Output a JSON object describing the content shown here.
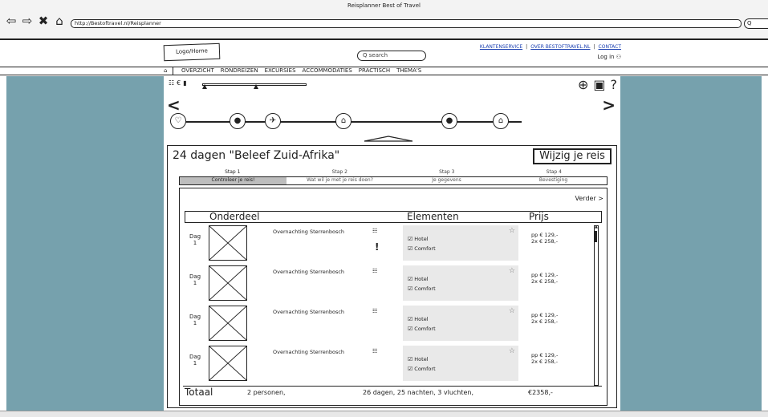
{
  "window": {
    "title": "Reisplanner Best of Travel"
  },
  "browser": {
    "url": "http://Bestoftravel.nl/Reisplanner",
    "search_placeholder": "Q"
  },
  "header": {
    "logo": "Logo/Home",
    "search_placeholder": "search",
    "links": [
      "KLANTENSERVICE",
      "OVER BESTOFTRAVEL.NL",
      "CONTACT"
    ],
    "login": "Log in"
  },
  "menu": {
    "items": [
      "OVERZICHT",
      "RONDREIZEN",
      "EXCURSIES",
      "ACCOMMODATIES",
      "PRACTISCH",
      "THEMA'S"
    ]
  },
  "trip": {
    "title": "24 dagen \"Beleef Zuid-Afrika\"",
    "change_button": "Wijzig je reis",
    "steps": [
      "Stap 1",
      "Stap 2",
      "Stap 3",
      "Stap 4"
    ],
    "step_tabs": [
      "Controleer je reis!",
      "Wat wil je met je reis doen?",
      "Je gegevens",
      "Bevestiging"
    ],
    "next": "Verder >",
    "columns": {
      "part": "Onderdeel",
      "elements": "Elementen",
      "price": "Prijs"
    },
    "rows": [
      {
        "day": "Dag",
        "day_num": "1",
        "part": "Overnachting Sterrenbosch",
        "el1": "Hotel",
        "el2": "Comfort",
        "price1": "pp € 129,-",
        "price2": "2x € 258,-"
      },
      {
        "day": "Dag",
        "day_num": "1",
        "part": "Overnachting Sterrenbosch",
        "el1": "Hotel",
        "el2": "Comfort",
        "price1": "pp € 129,-",
        "price2": "2x € 258,-"
      },
      {
        "day": "Dag",
        "day_num": "1",
        "part": "Overnachting Sterrenbosch",
        "el1": "Hotel",
        "el2": "Comfort",
        "price1": "pp € 129,-",
        "price2": "2x € 258,-"
      },
      {
        "day": "Dag",
        "day_num": "1",
        "part": "Overnachting Sterrenbosch",
        "el1": "Hotel",
        "el2": "Comfort",
        "price1": "pp € 129,-",
        "price2": "2x € 258,-"
      }
    ],
    "total": {
      "label": "Totaal",
      "persons": "2 personen,",
      "summary": "26 dagen, 25 nachten, 3 vluchten,",
      "amount": "€2358,-"
    }
  },
  "colors": {
    "side_bg": "#76a1ad",
    "element_bg": "#e9e9e9",
    "active_tab": "#bdbdbd"
  }
}
